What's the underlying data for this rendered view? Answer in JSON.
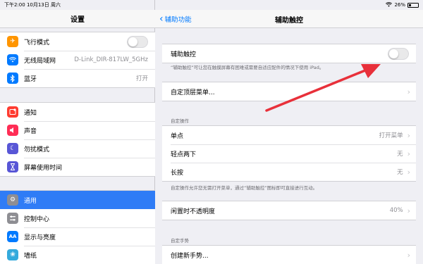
{
  "status_bar": {
    "time_date": "下午2:00  10月13日 周六",
    "battery_text": "26%",
    "battery_level": 0.26,
    "wifi_icon": "wifi-icon",
    "battery_icon": "battery-icon"
  },
  "sidebar": {
    "title": "设置",
    "groups": [
      {
        "items": [
          {
            "label": "飞行模式",
            "icon": "airplane-icon",
            "color": "#ff9500",
            "glyph": "✈",
            "type": "toggle",
            "toggle_on": false
          },
          {
            "label": "无线局域网",
            "icon": "wifi-icon",
            "color": "#007aff",
            "glyph": "≋",
            "value": "D-Link_DIR-817LW_5GHz"
          },
          {
            "label": "蓝牙",
            "icon": "bluetooth-icon",
            "color": "#007aff",
            "glyph": "ʙ",
            "value": "打开"
          }
        ]
      },
      {
        "items": [
          {
            "label": "通知",
            "icon": "notifications-icon",
            "color": "#ff3b30",
            "glyph": "▣"
          },
          {
            "label": "声音",
            "icon": "sound-icon",
            "color": "#ff2d55",
            "glyph": "♪"
          },
          {
            "label": "勿扰模式",
            "icon": "moon-icon",
            "color": "#5856d6",
            "glyph": "☾"
          },
          {
            "label": "屏幕使用时间",
            "icon": "hourglass-icon",
            "color": "#5856d6",
            "glyph": "⧗"
          }
        ]
      },
      {
        "items": [
          {
            "label": "通用",
            "icon": "gear-icon",
            "color": "#8e8e93",
            "glyph": "⚙",
            "selected": true
          },
          {
            "label": "控制中心",
            "icon": "control-center-icon",
            "color": "#8e8e93",
            "glyph": "▤"
          },
          {
            "label": "显示与亮度",
            "icon": "brightness-icon",
            "color": "#007aff",
            "glyph": "AA"
          },
          {
            "label": "墙纸",
            "icon": "wallpaper-icon",
            "color": "#34aadc",
            "glyph": "❀"
          }
        ]
      }
    ]
  },
  "detail": {
    "back_label": "辅助功能",
    "title": "辅助触控",
    "assistive_touch": {
      "label": "辅助触控",
      "toggle_on": false
    },
    "assistive_note": "“辅助触控”可让您在触摸屏幕有困难或需要自适应配件的情况下使用 iPad。",
    "custom_top_menu": "自定顶层菜单...",
    "custom_actions_header": "自定操作",
    "actions": [
      {
        "label": "单点",
        "value": "打开菜单"
      },
      {
        "label": "轻点两下",
        "value": "无"
      },
      {
        "label": "长按",
        "value": "无"
      }
    ],
    "actions_note": "自定操作允许您无需打开菜单，通过“辅助触控”图标即可直接进行互动。",
    "idle_opacity": {
      "label": "闲置时不透明度",
      "value": "40%"
    },
    "custom_gestures_header": "自定手势",
    "create_gesture": "创建新手势..."
  },
  "colors": {
    "accent": "#007aff",
    "selection": "#2f7cf6",
    "annotation_arrow": "#e8303a"
  }
}
